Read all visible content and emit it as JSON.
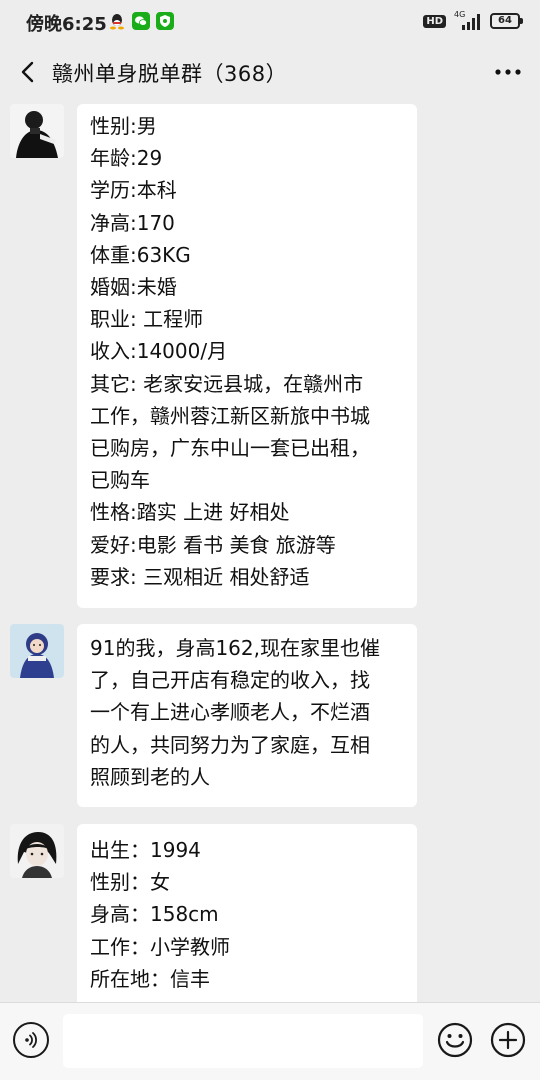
{
  "status_bar": {
    "time": "傍晚6:25",
    "hd": "HD",
    "network": "4G",
    "battery": "64"
  },
  "header": {
    "title": "赣州单身脱单群（368）"
  },
  "messages": [
    {
      "lines": [
        "性别:男",
        "年龄:29",
        "学历:本科",
        "净高:170",
        "体重:63KG",
        "婚姻:未婚",
        "职业: 工程师",
        "收入:14000/月",
        "其它: 老家安远县城，在赣州市",
        "工作，赣州蓉江新区新旅中书城",
        "已购房，广东中山一套已出租，",
        "已购车",
        "性格:踏实 上进 好相处",
        "爱好:电影 看书 美食 旅游等",
        "要求: 三观相近 相处舒适"
      ]
    },
    {
      "lines": [
        "91的我，身高162,现在家里也催",
        "了，自己开店有稳定的收入，找",
        "一个有上进心孝顺老人，不烂酒",
        "的人，共同努力为了家庭，互相",
        "照顾到老的人"
      ]
    },
    {
      "lines": [
        "出生：1994",
        "性别：女",
        "身高：158cm",
        "工作：小学教师",
        "所在地：信丰"
      ]
    }
  ],
  "input_bar": {
    "placeholder": ""
  }
}
